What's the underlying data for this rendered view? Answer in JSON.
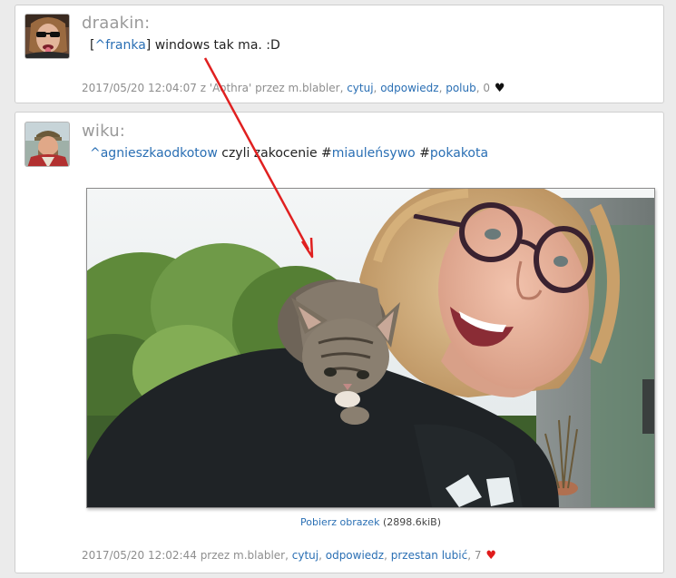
{
  "posts": [
    {
      "username": "draakin:",
      "message": {
        "bracket_open": "[",
        "mention": "^franka",
        "bracket_close": "]",
        "text": " windows tak ma. :D"
      },
      "meta": {
        "prefix": "2017/05/20 12:04:07 z 'Aothra' przez m.blabler, ",
        "quote": "cytuj",
        "reply": "odpowiedz",
        "like": "polub",
        "count": "0",
        "sep": ", "
      }
    },
    {
      "username": "wiku:",
      "message": {
        "mention": "^agnieszkaodkotow",
        "text1": " czyli zakocenie ",
        "hash1_mark": "#",
        "hash1": "miauleńsywo",
        "space": " ",
        "hash2_mark": "#",
        "hash2": "pokakota"
      },
      "download": {
        "link": "Pobierz obrazek",
        "size": " (2898.6kiB)"
      },
      "meta": {
        "prefix": "2017/05/20 12:02:44 przez m.blabler, ",
        "quote": "cytuj",
        "reply": "odpowiedz",
        "like": "przestan lubić",
        "count": "7",
        "sep": ", "
      }
    }
  ],
  "colors": {
    "link": "#2a6fb4",
    "heart_active": "#e01b1b",
    "heart_inactive": "#111111",
    "arrow": "#e02020"
  },
  "icons": {
    "like_icon": "heart-icon",
    "annotation": "red-arrow"
  }
}
